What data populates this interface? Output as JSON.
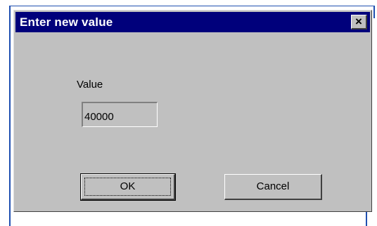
{
  "dialog": {
    "title": "Enter new value",
    "close_glyph": "×",
    "close_icon": "close-icon"
  },
  "form": {
    "value_label": "Value",
    "value": "40000"
  },
  "buttons": {
    "ok_label": "OK",
    "cancel_label": "Cancel"
  },
  "colors": {
    "titlebar": "#00007b",
    "dialog_bg": "#c0c0c0",
    "guide_lines": "#1f4fb0"
  }
}
